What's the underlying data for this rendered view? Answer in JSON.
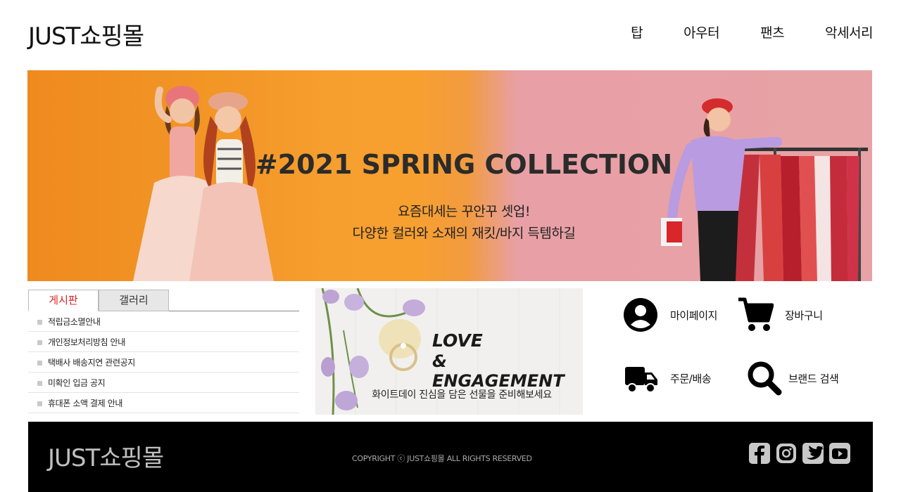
{
  "header": {
    "logo": "JUST쇼핑몰",
    "nav": [
      "탑",
      "아우터",
      "팬츠",
      "악세서리"
    ]
  },
  "hero": {
    "title": "#2021 SPRING COLLECTION",
    "subtitle_line1": "요즘대세는 꾸안꾸 셋업!",
    "subtitle_line2": "다양한 컬러와 소재의 재킷/바지 득템하길",
    "colors": {
      "left": "#f7a030",
      "right": "#e7a2a5"
    }
  },
  "board": {
    "tabs": [
      "게시판",
      "갤러리"
    ],
    "active_tab": "게시판",
    "items": [
      "적립금소멸안내",
      "개인정보처리방침 안내",
      "택배사 배송지연 관련공지",
      "미확인 입금 공지",
      "휴대폰 소액 결제 안내"
    ]
  },
  "gallery": {
    "title_line1": "LOVE",
    "title_line2": "& ENGAGEMENT",
    "caption": "화이트데이  진심을 담은 선물을 준비해보세요"
  },
  "quick_links": [
    {
      "label": "마이페이지",
      "icon": "user-circle-icon"
    },
    {
      "label": "장바구니",
      "icon": "cart-icon"
    },
    {
      "label": "주문/배송",
      "icon": "truck-icon"
    },
    {
      "label": "브랜드 검색",
      "icon": "search-icon"
    }
  ],
  "footer": {
    "logo": "JUST쇼핑몰",
    "copyright": "COPYRIGHT ⓒ JUST쇼핑몰 ALL RIGHTS RESERVED",
    "social": [
      "facebook-icon",
      "instagram-icon",
      "twitter-icon",
      "youtube-icon"
    ]
  }
}
